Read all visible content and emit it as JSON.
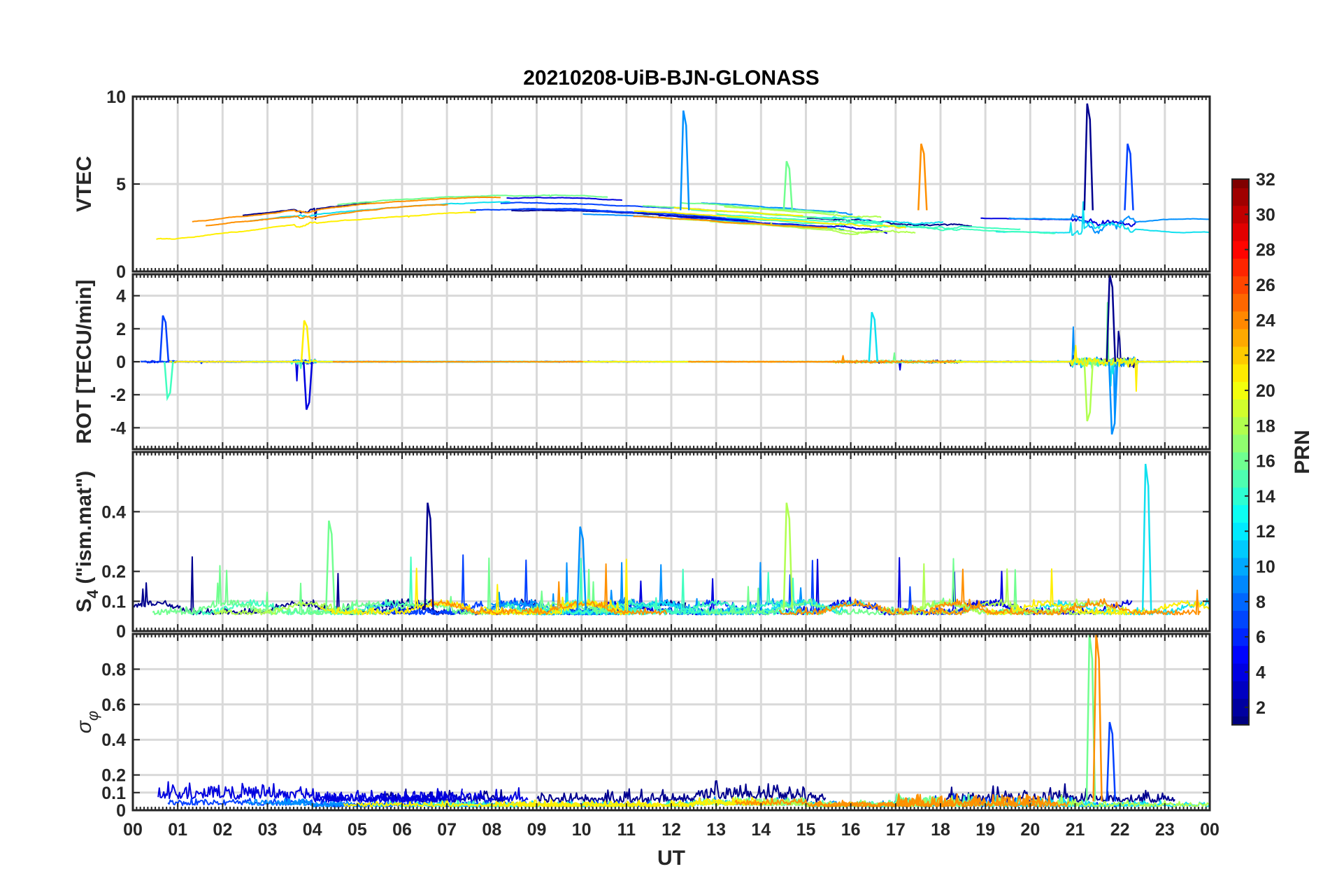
{
  "chart_data": {
    "type": "line",
    "title": "20210208-UiB-BJN-GLONASS",
    "xlabel": "UT",
    "x_ticks": [
      "00",
      "01",
      "02",
      "03",
      "04",
      "05",
      "06",
      "07",
      "08",
      "09",
      "10",
      "11",
      "12",
      "13",
      "14",
      "15",
      "16",
      "17",
      "18",
      "19",
      "20",
      "21",
      "22",
      "23",
      "00"
    ],
    "xlim": [
      0,
      24
    ],
    "grid": true,
    "panels": [
      {
        "id": "vtec",
        "ylabel": "VTEC",
        "ylim": [
          0,
          10
        ],
        "y_ticks": [
          0,
          5,
          10
        ],
        "typical_range": [
          1.5,
          5.5
        ],
        "events": [
          {
            "name": "peak-21.3",
            "x": 21.3,
            "y": 9.6
          },
          {
            "name": "peak-12.3",
            "x": 12.3,
            "y": 9.2
          },
          {
            "name": "peak-14.6",
            "x": 14.6,
            "y": 6.3
          },
          {
            "name": "peak-17.6",
            "x": 17.6,
            "y": 7.3
          },
          {
            "name": "peak-22.2",
            "x": 22.2,
            "y": 7.3
          }
        ]
      },
      {
        "id": "rot",
        "ylabel": "ROT [TECU/min]",
        "ylim": [
          -5.3,
          5.3
        ],
        "y_ticks": [
          -4,
          -2,
          0,
          2,
          4
        ],
        "events": [
          {
            "name": "spike-0.7",
            "x": 0.7,
            "y": 2.8
          },
          {
            "name": "spike-0.8",
            "x": 0.8,
            "y": -2.2
          },
          {
            "name": "spike-3.8",
            "x": 3.85,
            "y": 2.5
          },
          {
            "name": "spike-3.9",
            "x": 3.9,
            "y": -2.9
          },
          {
            "name": "spike-16.5",
            "x": 16.5,
            "y": 3.0
          },
          {
            "name": "spike-21.3",
            "x": 21.3,
            "y": -3.6
          },
          {
            "name": "spike-21.8",
            "x": 21.8,
            "y": 5.3
          },
          {
            "name": "spike-21.85",
            "x": 21.85,
            "y": -4.4
          }
        ]
      },
      {
        "id": "s4",
        "ylabel": "S4 (\"ism.mat\")",
        "ylabel_main": "S",
        "ylabel_sub": "4",
        "ylabel_rest": " (\"ism.mat\")",
        "ylim": [
          0,
          0.6
        ],
        "y_ticks": [
          0,
          0.1,
          0.2,
          0.4
        ],
        "y_tick_labels": [
          "0",
          "0.1",
          "0.2",
          "0.4"
        ],
        "events": [
          {
            "name": "peak-22.6",
            "x": 22.6,
            "y": 0.56
          },
          {
            "name": "peak-14.6",
            "x": 14.6,
            "y": 0.43
          },
          {
            "name": "peak-6.6",
            "x": 6.6,
            "y": 0.43
          },
          {
            "name": "peak-10.0",
            "x": 10.0,
            "y": 0.35
          },
          {
            "name": "peak-4.4",
            "x": 4.4,
            "y": 0.37
          }
        ]
      },
      {
        "id": "sigma-phi",
        "ylabel": "σφ",
        "ylabel_main": "σ",
        "ylabel_sub": "φ",
        "ylim": [
          0,
          1
        ],
        "y_ticks": [
          0,
          0.1,
          0.2,
          0.4,
          0.6,
          0.8
        ],
        "y_tick_labels": [
          "0",
          "0.1",
          "0.2",
          "0.4",
          "0.6",
          "0.8"
        ],
        "events": [
          {
            "name": "spike-21.35",
            "x": 21.35,
            "y": 1.0
          },
          {
            "name": "spike-21.5",
            "x": 21.5,
            "y": 1.0
          },
          {
            "name": "spike-21.8",
            "x": 21.8,
            "y": 0.5
          }
        ]
      }
    ],
    "colorbar": {
      "label": "PRN",
      "range": [
        1,
        32
      ],
      "ticks": [
        2,
        4,
        6,
        8,
        10,
        12,
        14,
        16,
        18,
        20,
        22,
        24,
        26,
        28,
        30,
        32
      ],
      "colormap": "jet"
    },
    "series": [
      {
        "prn": 1,
        "color": "#00008f"
      },
      {
        "prn": 3,
        "color": "#0000df"
      },
      {
        "prn": 6,
        "color": "#0040ff"
      },
      {
        "prn": 9,
        "color": "#0090ff"
      },
      {
        "prn": 12,
        "color": "#10e0ef"
      },
      {
        "prn": 14,
        "color": "#40ffbf"
      },
      {
        "prn": 16,
        "color": "#70ff8f"
      },
      {
        "prn": 18,
        "color": "#b0ff50"
      },
      {
        "prn": 20,
        "color": "#ffef00"
      },
      {
        "prn": 23,
        "color": "#ff9000"
      }
    ]
  }
}
